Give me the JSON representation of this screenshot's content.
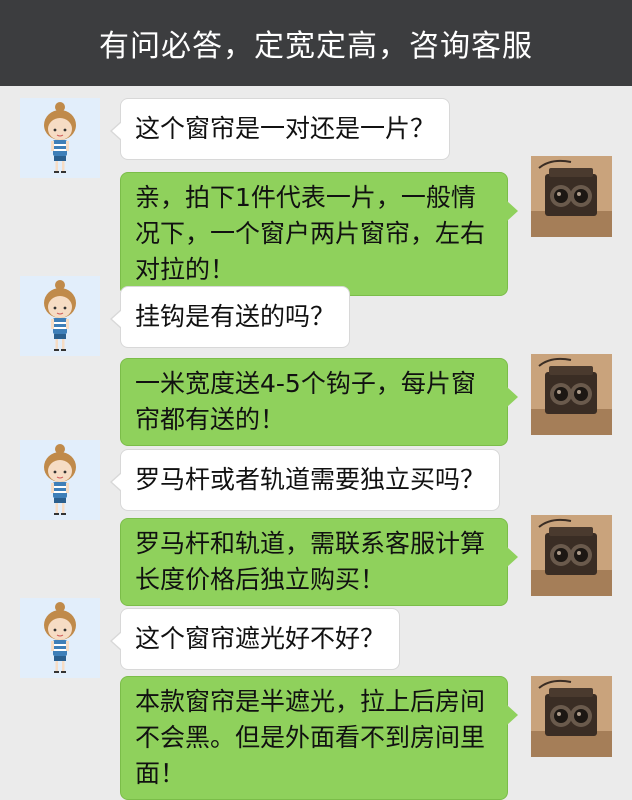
{
  "header": {
    "title": "有问必答，定宽定高，咨询客服"
  },
  "conversation": [
    {
      "question": "这个窗帘是一对还是一片？",
      "answer": "亲，拍下1件代表一片，一般情况下，一个窗户两片窗帘，左右对拉的！"
    },
    {
      "question": "挂钩是有送的吗？",
      "answer": "一米宽度送4-5个钩子，每片窗帘都有送的！"
    },
    {
      "question": "罗马杆或者轨道需要独立买吗？",
      "answer": "罗马杆和轨道，需联系客服计算长度价格后独立购买！"
    },
    {
      "question": "这个窗帘遮光好不好？",
      "answer": "本款窗帘是半遮光，拉上后房间不会黑。但是外面看不到房间里面！"
    }
  ],
  "avatars": {
    "customer": "girl-avatar",
    "service": "camera-avatar"
  },
  "colors": {
    "header_bg": "#3c3d3f",
    "page_bg": "#ebebeb",
    "answer_bubble": "#8fd15c",
    "question_bubble": "#ffffff",
    "customer_avatar_bg": "#e2eefb"
  }
}
